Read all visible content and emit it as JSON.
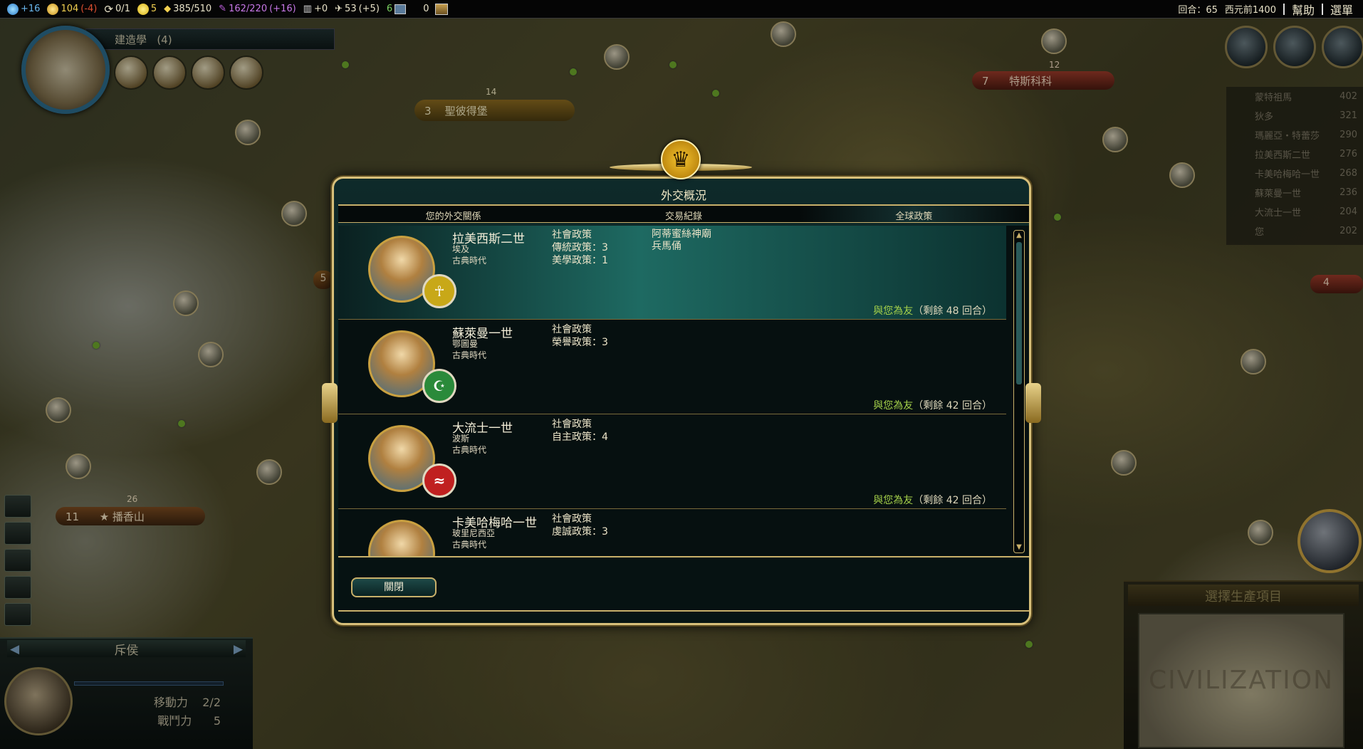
{
  "topbar": {
    "science": "+16",
    "gold": "104",
    "gold_delta": "(-4)",
    "trade_routes": "0/1",
    "happiness": "5",
    "golden_age": "385/510",
    "culture": "162/220",
    "culture_delta": "(+16)",
    "tourism": "+0",
    "faith": "53",
    "faith_delta": "(+5)",
    "great_people": "6",
    "spies": "0",
    "turn": "回合：65",
    "year": "西元前1400",
    "help": "幫助",
    "menu": "選單",
    "colors": {
      "science": "#4aa8e8",
      "gold": "#f2c530",
      "gold_delta": "#e05030",
      "culture": "#c060e0",
      "faith": "#e8e8e8"
    }
  },
  "research": {
    "label": "建造學",
    "turns": "(4)"
  },
  "map_tags": {
    "city1_pop": "11",
    "city1_name": "★ 播香山",
    "city1_strength": "26",
    "city2_pop": "3",
    "city2_name": "聖彼得堡",
    "city2_strength": "14",
    "city3_pop": "7",
    "city3_name": "特斯科科",
    "city3_strength": "12",
    "edge_pop_a": "5",
    "edge_pop_b": "4"
  },
  "unit": {
    "name": "斥侯",
    "moves_label": "移動力",
    "moves_value": "2/2",
    "strength_label": "戰鬥力",
    "strength_value": "5"
  },
  "scores": [
    {
      "name": "蒙特祖馬",
      "score": "402"
    },
    {
      "name": "狄多",
      "score": "321"
    },
    {
      "name": "瑪麗亞・特蕾莎",
      "score": "290"
    },
    {
      "name": "拉美西斯二世",
      "score": "276"
    },
    {
      "name": "卡美哈梅哈一世",
      "score": "268"
    },
    {
      "name": "蘇萊曼一世",
      "score": "236"
    },
    {
      "name": "大流士一世",
      "score": "204"
    },
    {
      "name": "您",
      "score": "202"
    }
  ],
  "production": {
    "title": "選擇生產項目",
    "minimap_watermark": "CIVILIZATION"
  },
  "dialog": {
    "title": "外交概況",
    "tabs": [
      "您的外交關係",
      "交易紀錄",
      "全球政策"
    ],
    "close_label": "關閉",
    "leaders": [
      {
        "name": "拉美西斯二世",
        "civ": "埃及",
        "era": "古典時代",
        "badge": "☥",
        "badge_color": "#c8a818",
        "policy_lines": [
          "社會政策",
          "傳統政策：3",
          "美學政策：1"
        ],
        "wonders": [
          "阿蒂蜜絲神廟",
          "兵馬俑"
        ],
        "status_friend": "與您為友",
        "status_rest": "（剩餘 48 回合）"
      },
      {
        "name": "蘇萊曼一世",
        "civ": "鄂圖曼",
        "era": "古典時代",
        "badge": "☪",
        "badge_color": "#2a8a3a",
        "policy_lines": [
          "社會政策",
          "榮譽政策：3"
        ],
        "wonders": [],
        "status_friend": "與您為友",
        "status_rest": "（剩餘 42 回合）"
      },
      {
        "name": "大流士一世",
        "civ": "波斯",
        "era": "古典時代",
        "badge": "≈",
        "badge_color": "#c02020",
        "policy_lines": [
          "社會政策",
          "自主政策：4"
        ],
        "wonders": [],
        "status_friend": "與您為友",
        "status_rest": "（剩餘 42 回合）"
      },
      {
        "name": "卡美哈梅哈一世",
        "civ": "玻里尼西亞",
        "era": "古典時代",
        "badge": "",
        "badge_color": "#1a4a8a",
        "policy_lines": [
          "社會政策",
          "虔誠政策：3"
        ],
        "wonders": [],
        "status_friend": "",
        "status_rest": ""
      }
    ]
  }
}
